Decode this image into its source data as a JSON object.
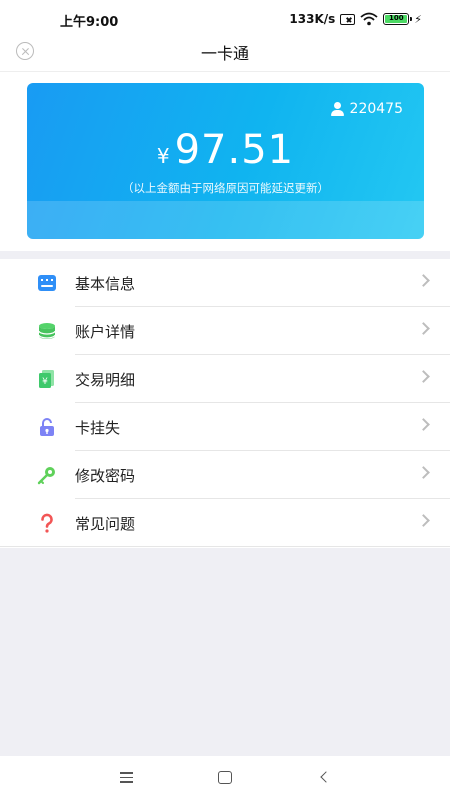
{
  "status_bar": {
    "time": "上午9:00",
    "network_speed": "133K/s",
    "battery": "100"
  },
  "nav": {
    "title": "一卡通",
    "close_icon": "close-circle-icon"
  },
  "card": {
    "user_id": "220475",
    "currency_symbol": "¥",
    "balance": "97.51",
    "note": "（以上金额由于网络原因可能延迟更新）",
    "colors": {
      "gradient_start": "#199bf3",
      "gradient_end": "#24c8f2"
    }
  },
  "menu": {
    "items": [
      {
        "label": "基本信息",
        "icon": "info-card-icon",
        "color": "#2f8ff7"
      },
      {
        "label": "账户详情",
        "icon": "coins-icon",
        "color": "#54d36a"
      },
      {
        "label": "交易明细",
        "icon": "receipt-icon",
        "color": "#3ec96b"
      },
      {
        "label": "卡挂失",
        "icon": "lock-icon",
        "color": "#7d83f5"
      },
      {
        "label": "修改密码",
        "icon": "key-icon",
        "color": "#5fd15a"
      },
      {
        "label": "常见问题",
        "icon": "question-icon",
        "color": "#f25555"
      }
    ]
  },
  "system_nav": {
    "menu_icon": "menu-icon",
    "home_icon": "home-icon",
    "back_icon": "back-icon"
  }
}
